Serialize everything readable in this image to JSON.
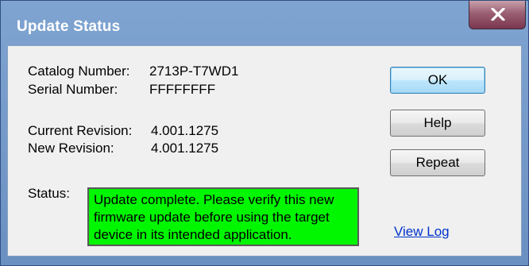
{
  "window": {
    "title": "Update Status",
    "close_glyph": "x"
  },
  "info": {
    "catalog_label": "Catalog Number:",
    "catalog_value": "2713P-T7WD1",
    "serial_label": "Serial Number:",
    "serial_value": "FFFFFFFF",
    "current_rev_label": "Current Revision:",
    "current_rev_value": "4.001.1275",
    "new_rev_label": "New Revision:",
    "new_rev_value": "4.001.1275",
    "status_label": "Status:",
    "status_text": "Update complete. Please verify this new firmware update before using the target device in its intended application."
  },
  "buttons": {
    "ok": "OK",
    "help": "Help",
    "repeat": "Repeat"
  },
  "links": {
    "view_log": "View Log"
  },
  "colors": {
    "status_background": "#00f700",
    "link": "#0033cc",
    "title_bar": "#6a90c2"
  },
  "icons": {
    "close": "close-icon"
  }
}
